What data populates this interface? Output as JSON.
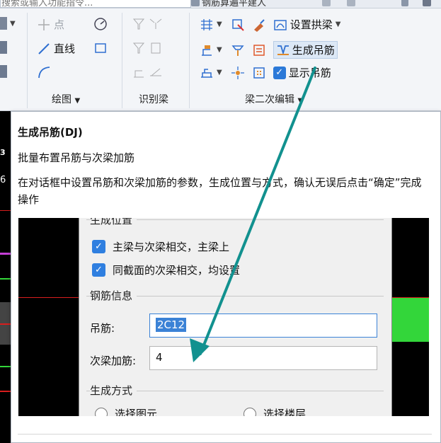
{
  "topbar": {
    "search_placeholder_truncated": "搜索或输入功能指令...",
    "app_title_truncated": "钢筋算遍平建人"
  },
  "ribbon": {
    "group_huitu": {
      "label": "绘图",
      "items": {
        "dian": "点",
        "zhixian": "直线"
      }
    },
    "group_shibie": {
      "label": "识别梁"
    },
    "group_erci": {
      "label": "梁二次编辑",
      "items": {
        "shezhi_gongliang": "设置拱梁",
        "shengcheng_diaojin": "生成吊筋",
        "xianshi_diaojin": "显示吊筋"
      }
    }
  },
  "tooltip": {
    "title": "生成吊筋(DJ)",
    "subtitle": "批量布置吊筋与次梁加筋",
    "description": "在对话框中设置吊筋和次梁加筋的参数，生成位置与方式，确认无误后点击“确定”完成操作",
    "preview": {
      "section_position": "生成位置",
      "cb1": "主梁与次梁相交，主梁上",
      "cb2": "同截面的次梁相交，均设置",
      "section_rebar": "钢筋信息",
      "diaojin_label": "吊筋:",
      "diaojin_value": "2C12",
      "cijia_label": "次梁加筋:",
      "cijia_value": "4",
      "section_method": "生成方式",
      "radio1": "选择图元",
      "radio2": "选择楼层"
    }
  },
  "colors": {
    "accent": "#2b79d8",
    "arrow": "#12918f",
    "green": "#33d63a",
    "red": "#d81e1e"
  }
}
